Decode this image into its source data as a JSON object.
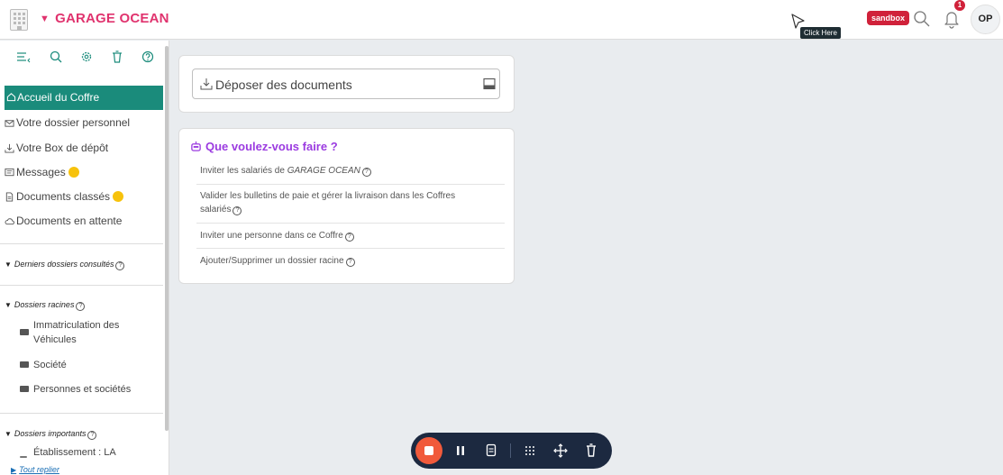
{
  "header": {
    "brand": "GARAGE OCEAN",
    "tooltip": "Click Here",
    "sandbox": "sandbox",
    "notification_count": "1",
    "avatar_initials": "OP"
  },
  "sidebar": {
    "nav": {
      "home": "Accueil du Coffre",
      "personal": "Votre dossier personnel",
      "box": "Votre Box de dépôt",
      "messages": "Messages",
      "classified": "Documents classés",
      "pending": "Documents en attente"
    },
    "sections": {
      "recent": "Derniers dossiers consultés",
      "roots": "Dossiers racines",
      "important": "Dossiers importants"
    },
    "root_folders": [
      "Immatriculation des",
      "Véhicules",
      "Société",
      "Personnes et sociétés"
    ],
    "important_folder": "Établissement : LA",
    "fold_all": "Tout replier"
  },
  "main": {
    "drop_label": "Déposer des documents",
    "what_title": "Que voulez-vous faire ?",
    "actions": {
      "invite_prefix": "Inviter les salariés de ",
      "invite_company": "GARAGE OCEAN",
      "validate_line1": "Valider les bulletins de paie et gérer la livraison dans les Coffres",
      "validate_line2": "salariés",
      "invite_person": "Inviter une personne dans ce Coffre",
      "root_folder": "Ajouter/Supprimer un dossier racine"
    }
  },
  "colors": {
    "brand": "#e0336e",
    "active_nav": "#1a8b7b",
    "title_purple": "#9b3be0",
    "sandbox_red": "#d0213a",
    "status_dot": "#f7c20c",
    "record_bar": "#1c2940",
    "record_stop": "#f15a3b"
  },
  "icons": [
    "building-logo-icon",
    "caret-down-icon",
    "cursor-icon",
    "search-icon",
    "bell-icon",
    "collapse-menu-icon",
    "gear-icon",
    "trash-icon",
    "help-icon",
    "home-icon",
    "envelope-icon",
    "download-icon",
    "message-icon",
    "document-icon",
    "cloud-icon",
    "folder-icon",
    "robot-icon",
    "tray-icon",
    "stop-icon",
    "pause-icon",
    "notes-icon",
    "grid-dots-icon",
    "move-icon"
  ]
}
